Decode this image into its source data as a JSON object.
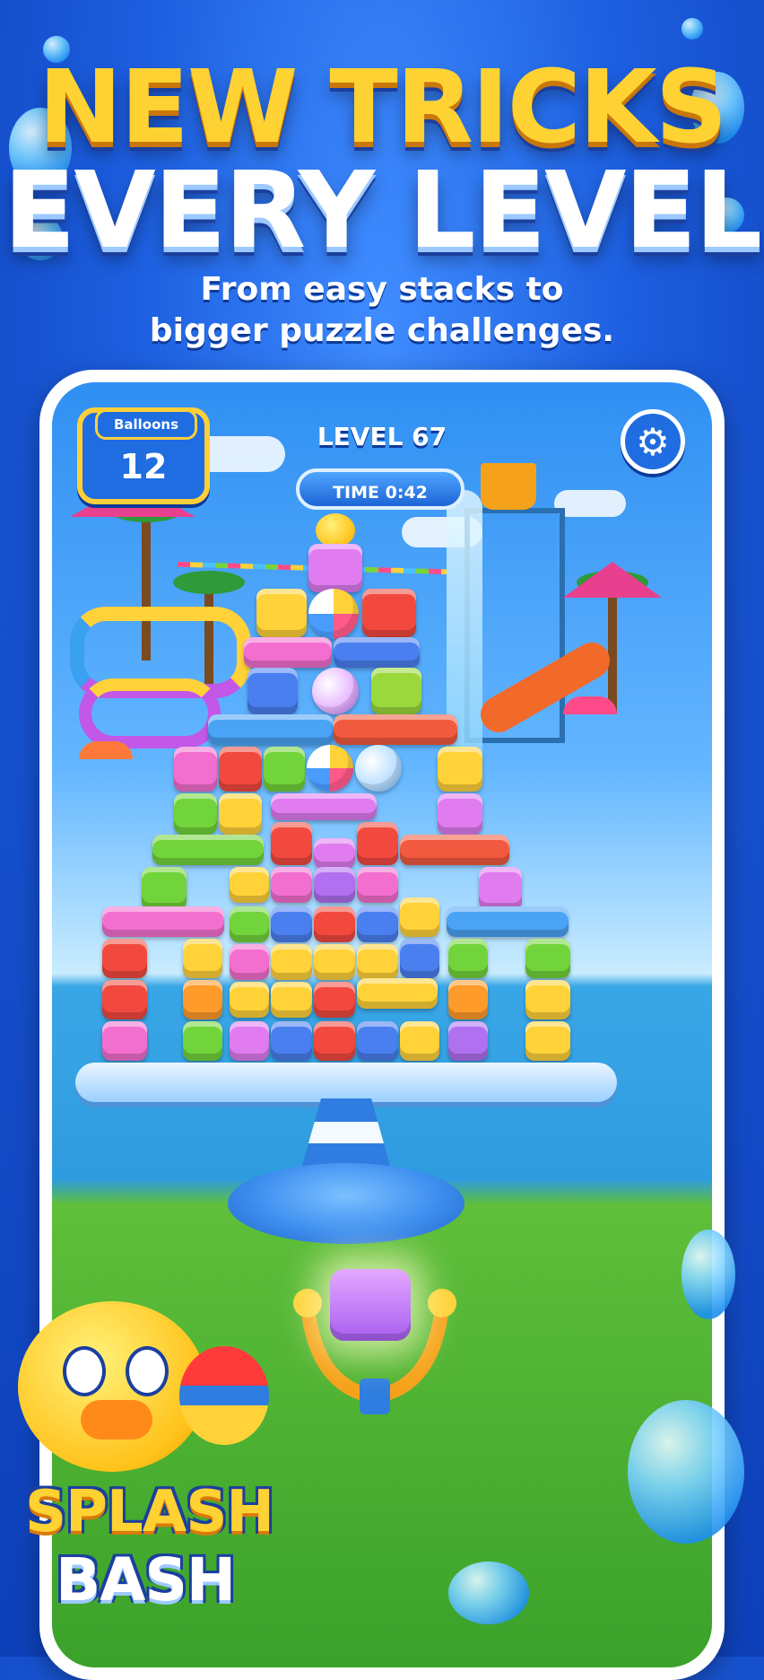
{
  "headline": {
    "line1": "NEW TRICKS",
    "line2": "EVERY LEVEL"
  },
  "subtitle": {
    "line1": "From easy stacks to",
    "line2": "bigger puzzle challenges."
  },
  "hud": {
    "balloons_label": "Balloons",
    "balloons_count": "12",
    "level": "LEVEL 67",
    "timer": "TIME 0:42",
    "settings_icon": "gear-icon"
  },
  "logo": {
    "line1": "SPLASH",
    "line2": "BASH"
  },
  "colors": {
    "pink": "#f36fcf",
    "red": "#f2493f",
    "yellow": "#ffd23a",
    "green": "#72d43b",
    "purple": "#b070f0",
    "blue": "#4a7ff0",
    "orange": "#ff9b2a",
    "accent": "#ffcf3a"
  }
}
